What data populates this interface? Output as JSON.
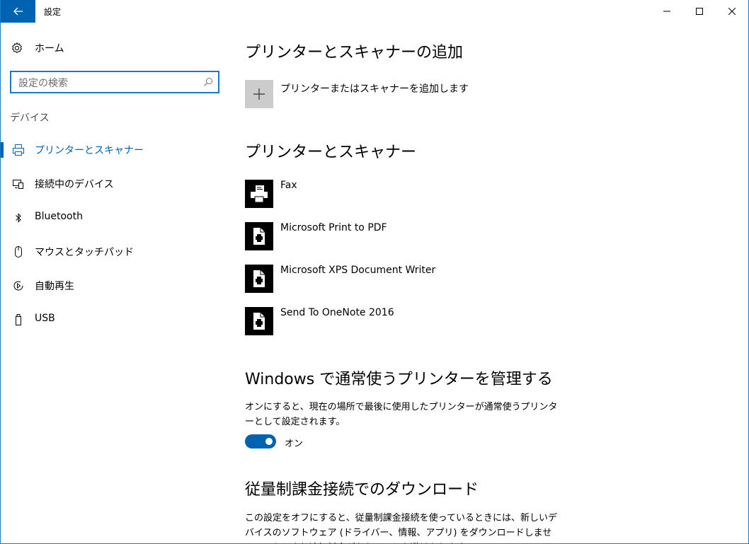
{
  "window": {
    "title": "設定",
    "controls": {
      "minimize": "minimize",
      "maximize": "maximize",
      "close": "close"
    }
  },
  "sidebar": {
    "home_label": "ホーム",
    "search_placeholder": "設定の検索",
    "section_label": "デバイス",
    "items": [
      {
        "label": "プリンターとスキャナー",
        "icon": "printer-icon",
        "active": true
      },
      {
        "label": "接続中のデバイス",
        "icon": "connected-devices-icon",
        "active": false
      },
      {
        "label": "Bluetooth",
        "icon": "bluetooth-icon",
        "active": false
      },
      {
        "label": "マウスとタッチパッド",
        "icon": "mouse-icon",
        "active": false
      },
      {
        "label": "自動再生",
        "icon": "autoplay-icon",
        "active": false
      },
      {
        "label": "USB",
        "icon": "usb-icon",
        "active": false
      }
    ]
  },
  "main": {
    "add_section": {
      "heading": "プリンターとスキャナーの追加",
      "add_label": "プリンターまたはスキャナーを追加します"
    },
    "list_section": {
      "heading": "プリンターとスキャナー",
      "devices": [
        {
          "name": "Fax",
          "icon": "fax-icon"
        },
        {
          "name": "Microsoft Print to PDF",
          "icon": "document-printer-icon"
        },
        {
          "name": "Microsoft XPS Document Writer",
          "icon": "document-printer-icon"
        },
        {
          "name": "Send To OneNote 2016",
          "icon": "document-printer-icon"
        }
      ]
    },
    "default_section": {
      "heading": "Windows で通常使うプリンターを管理する",
      "description": "オンにすると、現在の場所で最後に使用したプリンターが通常使うプリンターとして設定されます。",
      "toggle_label": "オン",
      "toggle_on": true
    },
    "metered_section": {
      "heading": "従量制課金接続でのダウンロード",
      "description": "この設定をオフにすると、従量制課金接続を使っているときには、新しいデバイスのソフトウェア (ドライバー、情報、アプリ) をダウンロードしません。これにより追加料金がかかることを避けられます。"
    }
  },
  "colors": {
    "accent": "#0063b1",
    "tile_gray": "#cccccc",
    "device_tile": "#000000"
  }
}
